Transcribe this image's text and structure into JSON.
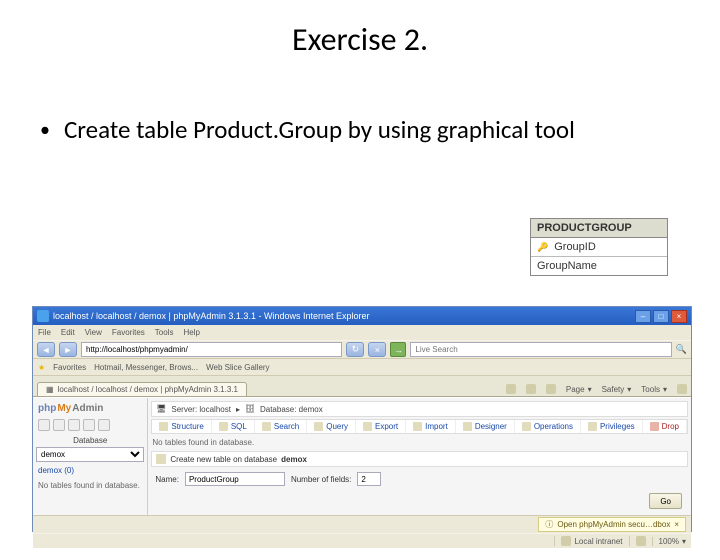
{
  "title": "Exercise 2.",
  "bullet": "Create table Product.Group by using graphical tool",
  "diagram": {
    "header": "PRODUCTGROUP",
    "rows": [
      "GroupID",
      "GroupName"
    ]
  },
  "ie": {
    "title": "localhost / localhost / demox | phpMyAdmin 3.1.3.1 - Windows Internet Explorer",
    "menu": [
      "File",
      "Edit",
      "View",
      "Favorites",
      "Tools",
      "Help"
    ],
    "address": "http://localhost/phpmyadmin/",
    "search_placeholder": "Live Search",
    "favorites": "Favorites",
    "favhint": "Hotmail, Messenger, Brows...",
    "webslice": "Web Slice Gallery",
    "tab": "localhost / localhost / demox | phpMyAdmin 3.1.3.1",
    "toolbar": {
      "page": "Page",
      "safety": "Safety",
      "tools": "Tools"
    },
    "logo": {
      "php": "php",
      "my": "My",
      "admin": "Admin"
    },
    "database_label": "Database",
    "database_value": "demox",
    "db_link": "demox (0)",
    "left_note": "No tables found in database.",
    "crumb_server": "Server: localhost",
    "crumb_db": "Database: demox",
    "mtabs": [
      "Structure",
      "SQL",
      "Search",
      "Query",
      "Export",
      "Import",
      "Designer",
      "Operations",
      "Privileges",
      "Drop"
    ],
    "main_notice": "No tables found in database.",
    "create_label": "Create new table on database",
    "create_db": "demox",
    "form": {
      "name_label": "Name:",
      "name_value": "ProductGroup",
      "fields_label": "Number of fields:",
      "fields_value": "2"
    },
    "go": "Go",
    "notif": "Open phpMyAdmin secu…dbox",
    "status2": {
      "intranet": "Local intranet",
      "zoom": "100%"
    }
  }
}
